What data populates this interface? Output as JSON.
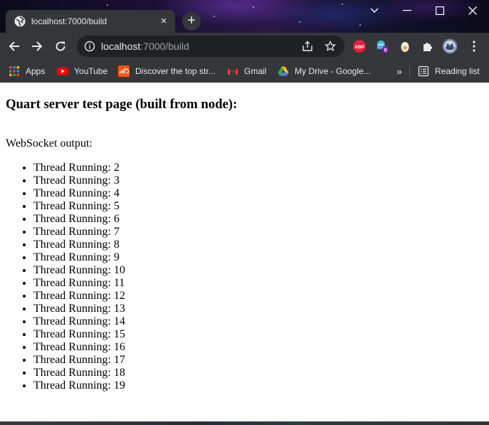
{
  "browser": {
    "tab": {
      "title": "localhost:7000/build",
      "close_label": "×"
    },
    "new_tab_label": "+",
    "address": {
      "host": "localhost",
      "rest": ":7000/build"
    },
    "bookmarks": [
      {
        "label": "Apps",
        "icon": "apps-grid-icon"
      },
      {
        "label": "YouTube",
        "icon": "youtube-icon"
      },
      {
        "label": "Discover the top str...",
        "icon": "soundcloud-icon"
      },
      {
        "label": "Gmail",
        "icon": "gmail-icon"
      },
      {
        "label": "My Drive - Google...",
        "icon": "google-drive-icon"
      }
    ],
    "overflow_label": "»",
    "reading_list_label": "Reading list",
    "extensions": [
      {
        "name": "adblock-plus-icon",
        "badge": "ABP"
      },
      {
        "name": "ghost-extension-icon",
        "badge": "0"
      },
      {
        "name": "egg-extension-icon"
      },
      {
        "name": "extensions-puzzle-icon"
      },
      {
        "name": "profile-avatar-icon"
      }
    ],
    "colors": {
      "chrome_dark": "#202124",
      "toolbar": "#35363a",
      "text": "#e8eaed"
    }
  },
  "page": {
    "heading": "Quart server test page (built from node):",
    "websocket_label": "WebSocket output:",
    "messages": [
      "Thread Running: 2",
      "Thread Running: 3",
      "Thread Running: 4",
      "Thread Running: 5",
      "Thread Running: 6",
      "Thread Running: 7",
      "Thread Running: 8",
      "Thread Running: 9",
      "Thread Running: 10",
      "Thread Running: 11",
      "Thread Running: 12",
      "Thread Running: 13",
      "Thread Running: 14",
      "Thread Running: 15",
      "Thread Running: 16",
      "Thread Running: 17",
      "Thread Running: 18",
      "Thread Running: 19"
    ]
  }
}
